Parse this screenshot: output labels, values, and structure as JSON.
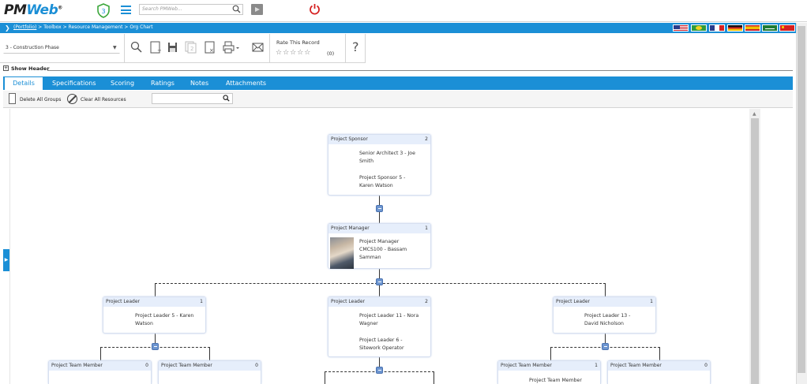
{
  "app": {
    "logo_part1": "PM",
    "logo_part2": "Web",
    "logo_mark": "®",
    "shield_badge": "3",
    "search_placeholder": "Search PMWeb..."
  },
  "breadcrumb": {
    "portfolio": "(Portfolio)",
    "rest": " > Toolbox > Resource Management > Org Chart"
  },
  "flags": [
    "us-flag",
    "brazil-flag",
    "france-flag",
    "germany-flag",
    "spain-flag",
    "saudi-flag",
    "china-flag"
  ],
  "toolbar": {
    "phase_value": "3 - Construction Phase",
    "rate_label": "Rate This Record",
    "stars": "☆☆☆☆☆",
    "rate_count": "(0)",
    "help": "?"
  },
  "show_header": "Show Header",
  "tabs": [
    "Details",
    "Specifications",
    "Scoring",
    "Ratings",
    "Notes",
    "Attachments"
  ],
  "actions": {
    "delete_groups": "Delete All Groups",
    "clear_resources": "Clear All Resources"
  },
  "org": {
    "sponsor": {
      "title": "Project Sponsor",
      "count": "2",
      "lines": [
        "Senior Architect 3 - Joe",
        "Smith",
        "Project Sponsor 5 -",
        "Karen Watson"
      ]
    },
    "manager": {
      "title": "Project Manager",
      "count": "1",
      "lines": [
        "Project Manager",
        "CMCS100 - Bassam",
        "Samman"
      ]
    },
    "leader1": {
      "title": "Project Leader",
      "count": "1",
      "lines": [
        "Project Leader 5 - Karen",
        "Watson"
      ]
    },
    "leader2": {
      "title": "Project Leader",
      "count": "2",
      "lines": [
        "Project Leader 11 - Nora",
        "Wagner",
        "Project Leader 6 -",
        "Sitework Operator"
      ]
    },
    "leader3": {
      "title": "Project Leader",
      "count": "1",
      "lines": [
        "Project Leader 13 -",
        "David Nicholson"
      ]
    },
    "member1": {
      "title": "Project Team Member",
      "count": "0"
    },
    "member2": {
      "title": "Project Team Member",
      "count": "0"
    },
    "member3": {
      "title": "Project Team Member",
      "count": "1",
      "lines": [
        "Project Team Member"
      ]
    },
    "member4": {
      "title": "Project Team Member",
      "count": "0"
    }
  }
}
